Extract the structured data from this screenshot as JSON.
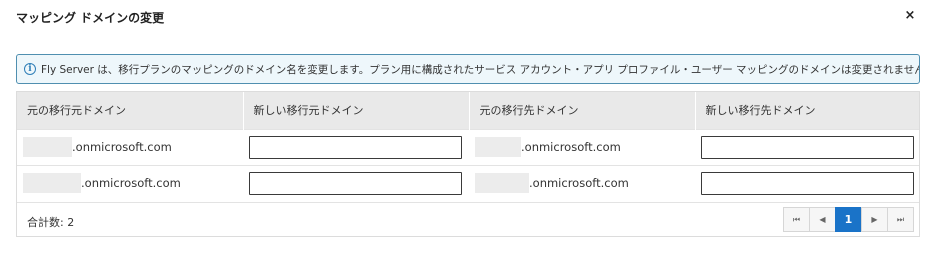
{
  "dialog": {
    "title": "マッピング ドメインの変更",
    "close_icon": "×"
  },
  "info": {
    "icon": "info-icon",
    "icon_glyph": "i",
    "message": "Fly Server は、移行プランのマッピングのドメイン名を変更します。プラン用に構成されたサービス アカウント・アプリ プロファイル・ユーザー マッピングのドメインは変更されません。"
  },
  "table": {
    "headers": [
      "元の移行元ドメイン",
      "新しい移行元ドメイン",
      "元の移行先ドメイン",
      "新しい移行先ドメイン"
    ],
    "rows": [
      {
        "source_domain": ".onmicrosoft.com",
        "new_source": "",
        "target_domain": ".onmicrosoft.com",
        "new_target": ""
      },
      {
        "source_domain": ".onmicrosoft.com",
        "new_source": "",
        "target_domain": ".onmicrosoft.com",
        "new_target": ""
      }
    ]
  },
  "footer": {
    "total_label": "合計数: 2",
    "pagination": {
      "first": "⏮",
      "prev": "◀",
      "current": "1",
      "next": "▶",
      "last": "⏭"
    }
  }
}
